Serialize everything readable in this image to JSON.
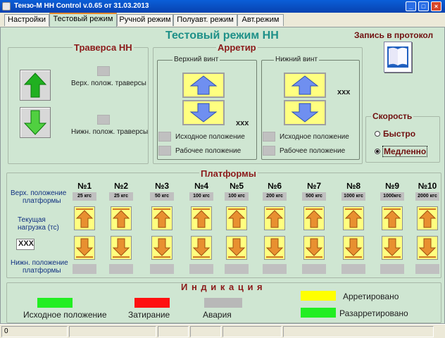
{
  "window": {
    "title": "Тензо-М   НН Control v.0.65  от 31.03.2013",
    "min": "_",
    "max": "□",
    "close": "×"
  },
  "tabs": [
    "Настройки",
    "Тестовый режим",
    "Ручной режим",
    "Полуавт. режим",
    "Авт.режим"
  ],
  "page_title": "Тестовый режим НН",
  "protocol": {
    "label": "Запись в протокол"
  },
  "traverse": {
    "title": "Траверса НН",
    "upper": "Верх. полож. траверсы",
    "lower": "Нижн. полож. траверсы"
  },
  "arretir": {
    "title": "Арретир",
    "top_screw": "Верхний винт",
    "bottom_screw": "Нижний винт",
    "xxx1": "ххх",
    "xxx2": "ххх",
    "home": "Исходное положение",
    "work": "Рабочее положение"
  },
  "speed": {
    "title": "Скорость",
    "fast": "Быстро",
    "slow": "Медленно",
    "selected": "slow"
  },
  "platforms": {
    "title": "Платформы",
    "upper_label_1": "Верх. положение",
    "upper_label_2": "платформы",
    "load_label_1": "Текущая",
    "load_label_2": "нагрузка (тс)",
    "load_value": "XXX",
    "lower_label_1": "Нижн. положение",
    "lower_label_2": "платформы",
    "items": [
      {
        "num": "№1",
        "cap": "25 кгс"
      },
      {
        "num": "№2",
        "cap": "25 кгс"
      },
      {
        "num": "№3",
        "cap": "50 кгс"
      },
      {
        "num": "№4",
        "cap": "100 кгс"
      },
      {
        "num": "№5",
        "cap": "100 кгс"
      },
      {
        "num": "№6",
        "cap": "200 кгс"
      },
      {
        "num": "№7",
        "cap": "500 кгс"
      },
      {
        "num": "№8",
        "cap": "1000 кгс"
      },
      {
        "num": "№9",
        "cap": "1000кгс"
      },
      {
        "num": "№10",
        "cap": "2000 кгс"
      }
    ]
  },
  "indication": {
    "title": "И н д и к а ц и я",
    "home": "Исходное положение",
    "jam": "Затирание",
    "alarm": "Авария",
    "arrested": "Арретировано",
    "unarrested": "Разарретировано",
    "colors": {
      "home": "#22ee22",
      "jam": "#ff1010",
      "alarm": "#b8b8b8",
      "arrested": "#ffff00",
      "unarrested": "#22ee22"
    }
  },
  "status": {
    "value": "0"
  }
}
